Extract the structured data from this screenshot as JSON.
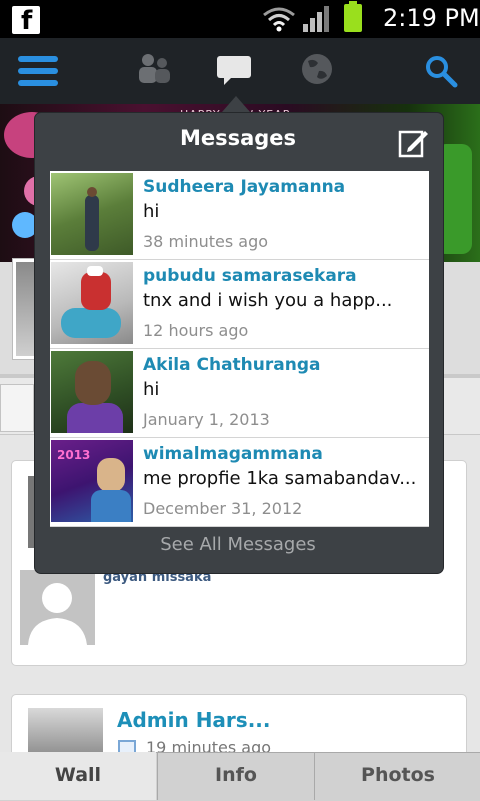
{
  "status_bar": {
    "time": "2:19 PM",
    "notification_icon": "facebook-icon",
    "icons": [
      "wifi-icon",
      "signal-icon",
      "battery-icon"
    ]
  },
  "toolbar": {
    "icons": [
      "menu-icon",
      "friends-icon",
      "chat-icon",
      "globe-icon",
      "search-icon"
    ],
    "accent_color": "#2a8fe0"
  },
  "background": {
    "cover_text": "HAPPY NEW YEAR",
    "post_author": "gayan missaka",
    "admin_post": {
      "name": "Admin Hars...",
      "time": "19 minutes ago"
    }
  },
  "messages_popup": {
    "title": "Messages",
    "see_all": "See All Messages",
    "messages": [
      {
        "name": "Sudheera Jayamanna",
        "text": "hi",
        "time": "38 minutes ago"
      },
      {
        "name": "pubudu samarasekara",
        "text": "tnx and i wish you a happ...",
        "time": "12 hours ago"
      },
      {
        "name": "Akila Chathuranga",
        "text": "hi",
        "time": "January 1, 2013"
      },
      {
        "name": "wimalmagammana",
        "text": "me propfie 1ka samabandav...",
        "time": "December 31, 2012"
      }
    ]
  },
  "bottom_tabs": {
    "wall": "Wall",
    "info": "Info",
    "photos": "Photos"
  }
}
